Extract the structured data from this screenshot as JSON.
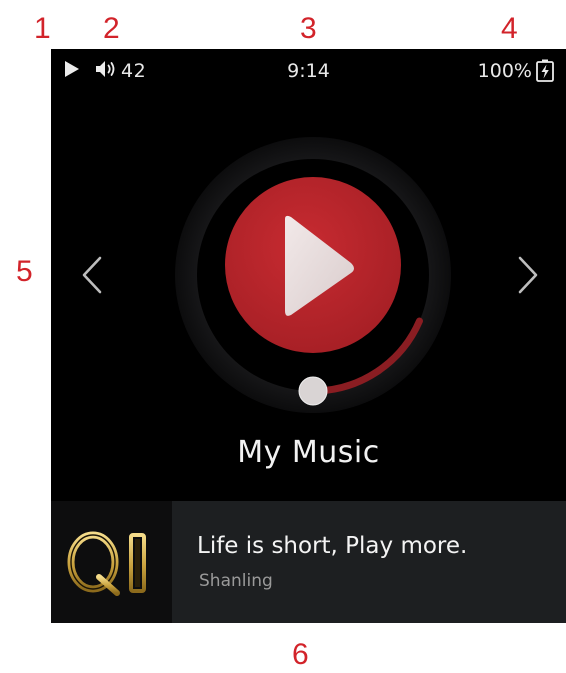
{
  "annotations": [
    "1",
    "2",
    "3",
    "4",
    "5",
    "6"
  ],
  "status_bar": {
    "play_state_icon": "play-icon",
    "volume_icon": "speaker-icon",
    "volume": "42",
    "time": "9:14",
    "battery_percent": "100%",
    "battery_icon": "battery-charging-icon"
  },
  "navigation": {
    "prev_icon": "chevron-left-icon",
    "next_icon": "chevron-right-icon"
  },
  "player": {
    "play_icon": "play-icon",
    "progress": 0.27,
    "section_title": "My Music"
  },
  "banner": {
    "logo_text": "QI",
    "title": "Life is short, Play more.",
    "subtitle": "Shanling"
  },
  "colors": {
    "accent": "#c0272d",
    "screen_background": "#000000",
    "annotation": "#d2232a"
  }
}
